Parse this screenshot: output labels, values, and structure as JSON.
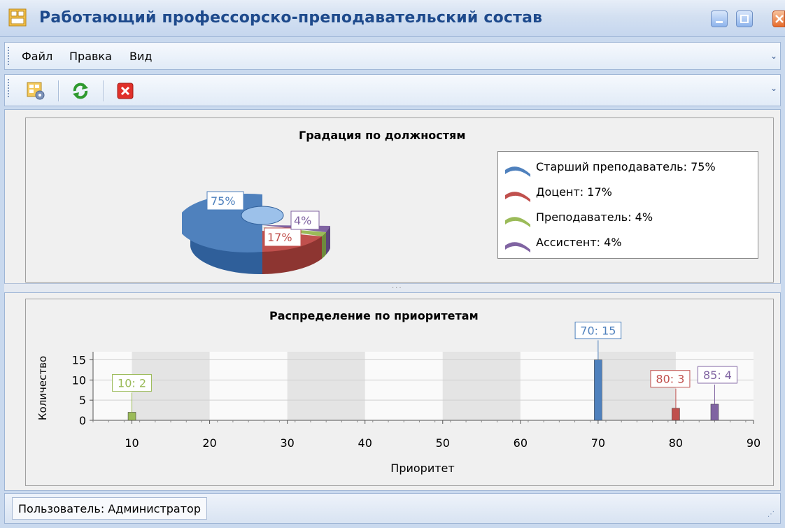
{
  "window": {
    "title": "Работающий профессорско-преподавательский состав"
  },
  "menu": {
    "items": [
      "Файл",
      "Правка",
      "Вид"
    ]
  },
  "toolbar": {
    "buttons": [
      {
        "icon": "settings-grid-icon"
      },
      {
        "icon": "refresh-icon"
      },
      {
        "icon": "close-red-icon"
      }
    ]
  },
  "pie": {
    "title": "Градация по должностям",
    "legend": [
      {
        "label": "Старший преподаватель: 75%",
        "color": "#4f81bd"
      },
      {
        "label": "Доцент: 17%",
        "color": "#c0504d"
      },
      {
        "label": "Преподаватель: 4%",
        "color": "#9bbb59"
      },
      {
        "label": "Ассистент: 4%",
        "color": "#8064a2"
      }
    ],
    "labels": {
      "senior": "75%",
      "docent": "17%",
      "assistant": "4%"
    }
  },
  "bar": {
    "title": "Распределение по приоритетам",
    "xlabel": "Приоритет",
    "ylabel": "Количество"
  },
  "status": {
    "user": "Пользователь: Администратор"
  },
  "chart_data": [
    {
      "type": "pie",
      "title": "Градация по должностям",
      "categories": [
        "Старший преподаватель",
        "Доцент",
        "Преподаватель",
        "Ассистент"
      ],
      "values": [
        75,
        17,
        4,
        4
      ],
      "colors": [
        "#4f81bd",
        "#c0504d",
        "#9bbb59",
        "#8064a2"
      ],
      "legend_position": "right"
    },
    {
      "type": "bar",
      "title": "Распределение по приоритетам",
      "xlabel": "Приоритет",
      "ylabel": "Количество",
      "x": [
        10,
        70,
        80,
        85
      ],
      "values": [
        2,
        15,
        3,
        4
      ],
      "point_labels": [
        "10: 2",
        "70: 15",
        "80: 3",
        "85: 4"
      ],
      "colors": [
        "#9bbb59",
        "#4f81bd",
        "#c0504d",
        "#8064a2"
      ],
      "xlim": [
        5,
        90
      ],
      "ylim": [
        0,
        17
      ],
      "xticks": [
        "10",
        "20",
        "30",
        "40",
        "50",
        "60",
        "70",
        "80",
        "90"
      ],
      "yticks": [
        "0",
        "5",
        "10",
        "15"
      ],
      "xtick_values": [
        10,
        20,
        30,
        40,
        50,
        60,
        70,
        80,
        90
      ],
      "ytick_values": [
        0,
        5,
        10,
        15
      ]
    }
  ]
}
